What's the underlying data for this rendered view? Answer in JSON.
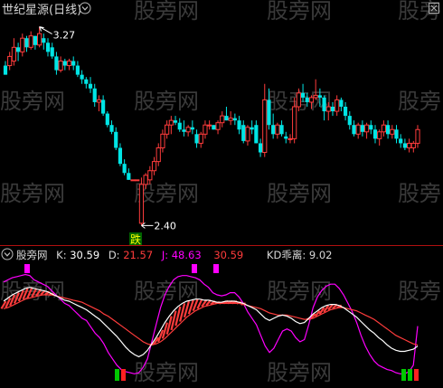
{
  "watermark": {
    "text": "股旁网",
    "color": "#3a3a3a"
  },
  "colors": {
    "bg": "#000000",
    "divider": "#b01010",
    "up": "#ff3c3c",
    "down": "#00e5e5",
    "k_line": "#ffffff",
    "d_line": "#ff3c3c",
    "j_line": "#ff00ff",
    "magenta_marker": "#ff00ff",
    "green_marker": "#00c800",
    "red_marker": "#ff2020",
    "label_text": "#d8d8d8",
    "value_yellow": "#ffff00",
    "value_white": "#ffffff"
  },
  "main_panel": {
    "title": "世纪星源(日线)",
    "collapse_icon": "chevron-down-icon",
    "close_icon": "close-icon",
    "high_label": "3.27",
    "low_label": "2.40",
    "signal_label": "跌"
  },
  "indicator_panel": {
    "name": "股旁网",
    "k_label": "K: ",
    "k_value": "30.59",
    "d_label": "D: ",
    "d_value": "21.57",
    "j_label": "J: ",
    "j_value": "48.63",
    "extra_value": "30.59",
    "divergence_label": "KD乖离: ",
    "divergence_value": "9.02",
    "collapse_icon": "chevron-down-icon"
  },
  "chart_data": [
    {
      "type": "candlestick",
      "title": "世纪星源(日线)",
      "ylim": [
        2.35,
        3.3
      ],
      "annotations": [
        {
          "label": "3.27",
          "at": 3.27,
          "bar": 8
        },
        {
          "label": "2.40",
          "at": 2.4,
          "bar": 32
        },
        {
          "label": "跌",
          "bar": 30
        }
      ],
      "ohlc": [
        [
          3.1,
          3.12,
          3.06,
          3.06
        ],
        [
          3.1,
          3.16,
          3.08,
          3.14
        ],
        [
          3.12,
          3.22,
          3.1,
          3.18
        ],
        [
          3.18,
          3.2,
          3.12,
          3.16
        ],
        [
          3.16,
          3.24,
          3.14,
          3.22
        ],
        [
          3.22,
          3.23,
          3.16,
          3.18
        ],
        [
          3.18,
          3.25,
          3.17,
          3.23
        ],
        [
          3.23,
          3.23,
          3.17,
          3.19
        ],
        [
          3.19,
          3.27,
          3.18,
          3.24
        ],
        [
          3.22,
          3.24,
          3.17,
          3.2
        ],
        [
          3.2,
          3.22,
          3.14,
          3.16
        ],
        [
          3.18,
          3.2,
          3.13,
          3.14
        ],
        [
          3.14,
          3.16,
          3.06,
          3.08
        ],
        [
          3.08,
          3.14,
          3.07,
          3.12
        ],
        [
          3.12,
          3.13,
          3.08,
          3.1
        ],
        [
          3.1,
          3.13,
          3.08,
          3.12
        ],
        [
          3.12,
          3.14,
          3.08,
          3.1
        ],
        [
          3.1,
          3.12,
          3.05,
          3.06
        ],
        [
          3.06,
          3.08,
          3.02,
          3.04
        ],
        [
          3.04,
          3.05,
          3.0,
          3.02
        ],
        [
          3.02,
          3.05,
          2.98,
          3.0
        ],
        [
          3.0,
          3.02,
          2.92,
          2.94
        ],
        [
          2.94,
          2.97,
          2.9,
          2.95
        ],
        [
          2.95,
          2.97,
          2.88,
          2.89
        ],
        [
          2.89,
          2.9,
          2.83,
          2.84
        ],
        [
          2.84,
          2.86,
          2.8,
          2.81
        ],
        [
          2.81,
          2.83,
          2.73,
          2.74
        ],
        [
          2.74,
          2.76,
          2.66,
          2.67
        ],
        [
          2.67,
          2.69,
          2.62,
          2.63
        ],
        [
          2.63,
          2.65,
          2.6,
          2.6
        ],
        [
          2.6,
          2.6,
          2.6,
          2.6
        ],
        [
          2.6,
          2.6,
          2.6,
          2.6
        ],
        [
          2.41,
          2.61,
          2.4,
          2.58
        ],
        [
          2.58,
          2.63,
          2.56,
          2.62
        ],
        [
          2.6,
          2.66,
          2.58,
          2.64
        ],
        [
          2.64,
          2.7,
          2.62,
          2.68
        ],
        [
          2.68,
          2.76,
          2.66,
          2.74
        ],
        [
          2.74,
          2.82,
          2.72,
          2.8
        ],
        [
          2.8,
          2.86,
          2.78,
          2.84
        ],
        [
          2.84,
          2.88,
          2.8,
          2.86
        ],
        [
          2.86,
          2.88,
          2.84,
          2.85
        ],
        [
          2.85,
          2.87,
          2.81,
          2.82
        ],
        [
          2.82,
          2.86,
          2.79,
          2.81
        ],
        [
          2.81,
          2.84,
          2.79,
          2.83
        ],
        [
          2.83,
          2.86,
          2.8,
          2.82
        ],
        [
          2.8,
          2.82,
          2.74,
          2.76
        ],
        [
          2.76,
          2.81,
          2.74,
          2.8
        ],
        [
          2.8,
          2.86,
          2.78,
          2.84
        ],
        [
          2.84,
          2.86,
          2.82,
          2.84
        ],
        [
          2.84,
          2.84,
          2.82,
          2.82
        ],
        [
          2.82,
          2.86,
          2.8,
          2.85
        ],
        [
          2.85,
          2.9,
          2.83,
          2.88
        ],
        [
          2.88,
          2.92,
          2.86,
          2.86
        ],
        [
          2.86,
          2.9,
          2.84,
          2.87
        ],
        [
          2.87,
          2.89,
          2.84,
          2.86
        ],
        [
          2.86,
          2.88,
          2.8,
          2.82
        ],
        [
          2.84,
          2.86,
          2.76,
          2.77
        ],
        [
          2.77,
          2.84,
          2.75,
          2.83
        ],
        [
          2.83,
          2.86,
          2.8,
          2.82
        ],
        [
          2.84,
          2.86,
          2.76,
          2.76
        ],
        [
          2.76,
          2.78,
          2.7,
          2.72
        ],
        [
          2.72,
          3.02,
          2.7,
          2.95
        ],
        [
          2.95,
          3.0,
          2.82,
          2.84
        ],
        [
          2.84,
          2.89,
          2.78,
          2.8
        ],
        [
          2.8,
          2.85,
          2.78,
          2.84
        ],
        [
          2.84,
          2.86,
          2.79,
          2.8
        ],
        [
          2.79,
          2.81,
          2.76,
          2.78
        ],
        [
          2.78,
          2.8,
          2.76,
          2.78
        ],
        [
          2.78,
          2.96,
          2.76,
          2.92
        ],
        [
          2.92,
          3.0,
          2.9,
          2.98
        ],
        [
          2.98,
          3.02,
          2.94,
          2.96
        ],
        [
          2.96,
          2.98,
          2.92,
          2.94
        ],
        [
          2.94,
          2.97,
          2.91,
          2.96
        ],
        [
          2.96,
          3.04,
          2.95,
          2.97
        ],
        [
          2.97,
          3.0,
          2.92,
          2.96
        ],
        [
          2.96,
          2.97,
          2.86,
          2.9
        ],
        [
          2.9,
          2.94,
          2.86,
          2.92
        ],
        [
          2.92,
          2.94,
          2.88,
          2.9
        ],
        [
          2.9,
          2.97,
          2.88,
          2.95
        ],
        [
          2.95,
          2.96,
          2.9,
          2.92
        ],
        [
          2.92,
          2.94,
          2.86,
          2.88
        ],
        [
          2.88,
          2.9,
          2.82,
          2.84
        ],
        [
          2.84,
          2.86,
          2.79,
          2.8
        ],
        [
          2.8,
          2.85,
          2.78,
          2.84
        ],
        [
          2.84,
          2.86,
          2.79,
          2.81
        ],
        [
          2.81,
          2.85,
          2.78,
          2.84
        ],
        [
          2.84,
          2.86,
          2.8,
          2.82
        ],
        [
          2.82,
          2.84,
          2.76,
          2.78
        ],
        [
          2.78,
          2.82,
          2.75,
          2.81
        ],
        [
          2.81,
          2.86,
          2.79,
          2.84
        ],
        [
          2.84,
          2.86,
          2.78,
          2.8
        ],
        [
          2.8,
          2.84,
          2.78,
          2.82
        ],
        [
          2.82,
          2.84,
          2.76,
          2.78
        ],
        [
          2.78,
          2.8,
          2.74,
          2.76
        ],
        [
          2.76,
          2.78,
          2.73,
          2.74
        ],
        [
          2.74,
          2.78,
          2.72,
          2.76
        ],
        [
          2.74,
          2.77,
          2.72,
          2.76
        ],
        [
          2.76,
          2.84,
          2.74,
          2.82
        ]
      ]
    },
    {
      "type": "line",
      "name": "KD indicator",
      "ylim": [
        0,
        100
      ],
      "series": [
        {
          "name": "K",
          "values": [
            72,
            75,
            78,
            80,
            82,
            84,
            85,
            84,
            83,
            82,
            81,
            79,
            77,
            75,
            73,
            72,
            70,
            68,
            66,
            64,
            61,
            58,
            55,
            51,
            47,
            43,
            39,
            34,
            29,
            25,
            22,
            20,
            22,
            26,
            32,
            38,
            45,
            52,
            58,
            63,
            67,
            70,
            72,
            73,
            74,
            74,
            73,
            73,
            72,
            71,
            71,
            72,
            72,
            72,
            71,
            70,
            68,
            66,
            64,
            60,
            56,
            54,
            56,
            58,
            59,
            58,
            56,
            53,
            51,
            52,
            56,
            60,
            63,
            66,
            68,
            69,
            69,
            68,
            66,
            63,
            60,
            57,
            53,
            49,
            45,
            42,
            38,
            35,
            31,
            28,
            26,
            25,
            25,
            26,
            27,
            30
          ]
        },
        {
          "name": "D",
          "values": [
            65,
            66,
            68,
            70,
            72,
            74,
            75,
            76,
            77,
            78,
            78,
            78,
            77,
            76,
            75,
            74,
            73,
            72,
            71,
            69,
            67,
            65,
            63,
            60,
            58,
            55,
            52,
            49,
            46,
            43,
            40,
            37,
            34,
            32,
            31,
            32,
            34,
            37,
            41,
            45,
            49,
            53,
            57,
            60,
            63,
            65,
            67,
            68,
            69,
            70,
            70,
            70,
            70,
            70,
            70,
            69,
            68,
            67,
            66,
            65,
            63,
            61,
            60,
            59,
            59,
            59,
            58,
            57,
            56,
            55,
            55,
            56,
            58,
            60,
            62,
            64,
            65,
            66,
            66,
            65,
            64,
            63,
            61,
            59,
            57,
            55,
            52,
            49,
            46,
            43,
            40,
            38,
            36,
            34,
            32,
            31
          ]
        },
        {
          "name": "J",
          "values": [
            90,
            92,
            94,
            95,
            96,
            97,
            96,
            92,
            90,
            88,
            86,
            82,
            78,
            74,
            70,
            68,
            64,
            60,
            56,
            54,
            48,
            42,
            38,
            32,
            24,
            18,
            12,
            8,
            6,
            5,
            4,
            5,
            10,
            18,
            34,
            50,
            66,
            78,
            86,
            92,
            95,
            96,
            96,
            95,
            94,
            92,
            88,
            85,
            80,
            78,
            77,
            78,
            80,
            80,
            76,
            70,
            62,
            56,
            50,
            40,
            30,
            24,
            28,
            36,
            44,
            46,
            44,
            38,
            34,
            36,
            50,
            66,
            76,
            82,
            86,
            88,
            88,
            84,
            78,
            70,
            62,
            52,
            40,
            30,
            22,
            16,
            12,
            10,
            8,
            7,
            5,
            4,
            4,
            6,
            12,
            48.63
          ]
        }
      ],
      "bars": {
        "name": "KD乖离",
        "last": 9.02
      }
    }
  ]
}
